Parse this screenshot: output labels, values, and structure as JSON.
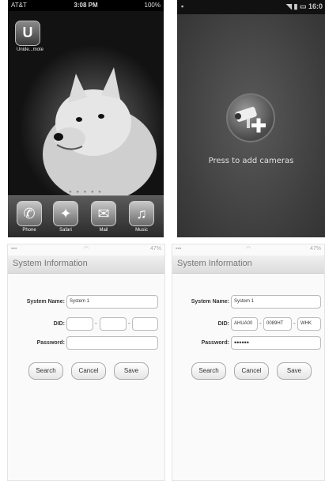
{
  "home": {
    "carrier": "AT&T",
    "time": "3:08 PM",
    "battery": "100%",
    "app_label": "Unide...mote",
    "app_glyph": "U",
    "dock": [
      {
        "label": "Phone",
        "icon": "phone-icon",
        "glyph": "✆"
      },
      {
        "label": "Safari",
        "icon": "safari-icon",
        "glyph": "✦"
      },
      {
        "label": "Mail",
        "icon": "mail-icon",
        "glyph": "✉"
      },
      {
        "label": "Music",
        "icon": "music-icon",
        "glyph": "♫"
      }
    ]
  },
  "android": {
    "time": "16:0",
    "prompt": "Press to add cameras"
  },
  "form_empty": {
    "battery": "47%",
    "title": "System Information",
    "system_name_label": "System Name:",
    "system_name_value": "System 1",
    "did_label": "DID:",
    "did_values": [
      "",
      "",
      ""
    ],
    "password_label": "Password:",
    "password_value": "",
    "buttons": [
      "Search",
      "Cancel",
      "Save"
    ]
  },
  "form_filled": {
    "battery": "47%",
    "title": "System Information",
    "system_name_label": "System Name:",
    "system_name_value": "System 1",
    "did_label": "DID:",
    "did_values": [
      "AHUA00",
      "0089HT",
      "WHK"
    ],
    "password_label": "Password:",
    "password_value": "••••••",
    "buttons": [
      "Search",
      "Cancel",
      "Save"
    ]
  }
}
